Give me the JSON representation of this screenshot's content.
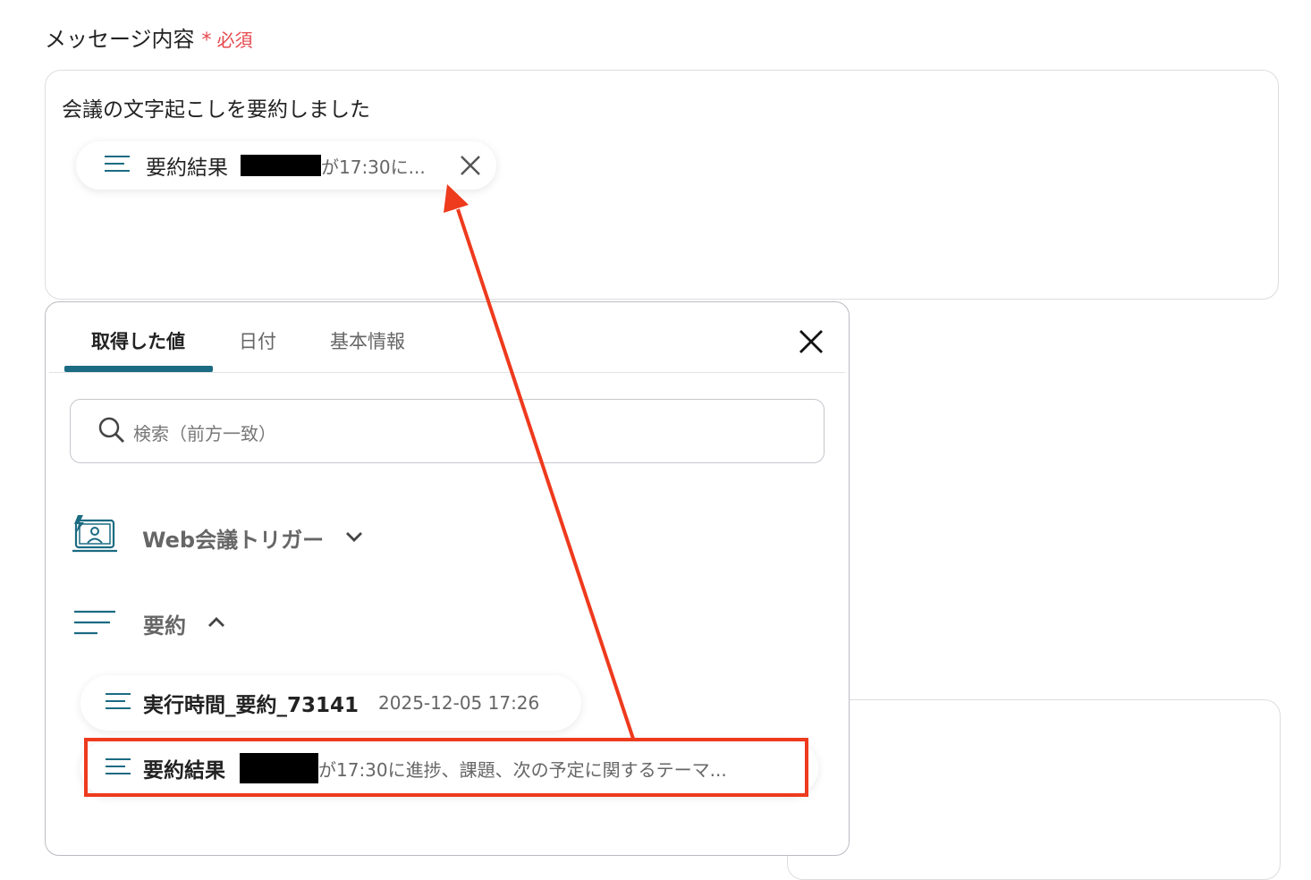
{
  "field": {
    "label": "メッセージ内容",
    "required_star": "*",
    "required_text": "必須"
  },
  "message": {
    "text": "会議の文字起こしを要約しました",
    "chip": {
      "title": "要約結果",
      "value": "が17:30に..."
    }
  },
  "panel": {
    "tabs": [
      {
        "label": "取得した値",
        "active": true
      },
      {
        "label": "日付",
        "active": false
      },
      {
        "label": "基本情報",
        "active": false
      }
    ],
    "search": {
      "placeholder": "検索（前方一致）"
    },
    "sections": [
      {
        "title": "Web会議トリガー",
        "expanded": false,
        "icon": "video-meeting-icon"
      },
      {
        "title": "要約",
        "expanded": true,
        "icon": "lines-icon"
      }
    ],
    "items": [
      {
        "title": "実行時間_要約_73141",
        "value": "2025-12-05 17:26"
      },
      {
        "title": "要約結果",
        "value": "が17:30に進捗、課題、次の予定に関するテーマ..."
      }
    ]
  },
  "colors": {
    "accent": "#1b6b82",
    "required": "#e5484d",
    "annotation": "#ee3a1d"
  }
}
